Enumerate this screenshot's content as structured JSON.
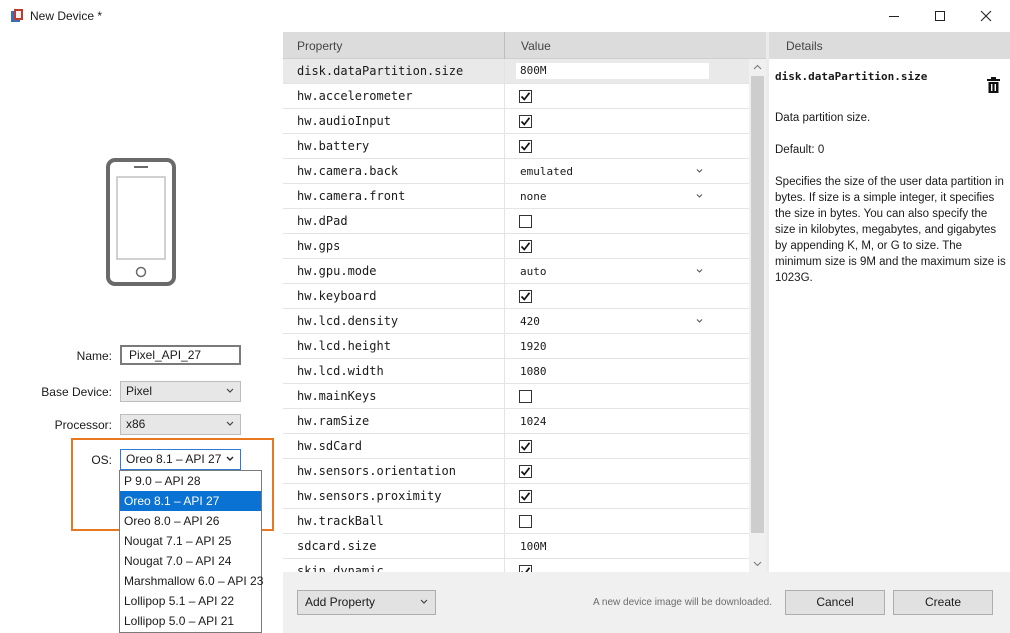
{
  "window": {
    "title": "New Device *"
  },
  "form": {
    "name_label": "Name:",
    "name_value": "Pixel_API_27",
    "base_device_label": "Base Device:",
    "base_device_value": "Pixel",
    "processor_label": "Processor:",
    "processor_value": "x86",
    "os_label": "OS:",
    "os_value": "Oreo 8.1 – API 27"
  },
  "os_options": [
    "P 9.0 – API 28",
    "Oreo 8.1 – API 27",
    "Oreo 8.0 – API 26",
    "Nougat 7.1 – API 25",
    "Nougat 7.0 – API 24",
    "Marshmallow 6.0 – API 23",
    "Lollipop 5.1 – API 22",
    "Lollipop 5.0 – API 21"
  ],
  "os_selected_index": 1,
  "grid": {
    "property_header": "Property",
    "value_header": "Value",
    "rows": [
      {
        "name": "disk.dataPartition.size",
        "type": "text",
        "value": "800M",
        "selected": true
      },
      {
        "name": "hw.accelerometer",
        "type": "check",
        "checked": true
      },
      {
        "name": "hw.audioInput",
        "type": "check",
        "checked": true
      },
      {
        "name": "hw.battery",
        "type": "check",
        "checked": true
      },
      {
        "name": "hw.camera.back",
        "type": "combo",
        "value": "emulated"
      },
      {
        "name": "hw.camera.front",
        "type": "combo",
        "value": "none"
      },
      {
        "name": "hw.dPad",
        "type": "check",
        "checked": false
      },
      {
        "name": "hw.gps",
        "type": "check",
        "checked": true
      },
      {
        "name": "hw.gpu.mode",
        "type": "combo",
        "value": "auto"
      },
      {
        "name": "hw.keyboard",
        "type": "check",
        "checked": true
      },
      {
        "name": "hw.lcd.density",
        "type": "combo",
        "value": "420"
      },
      {
        "name": "hw.lcd.height",
        "type": "text",
        "value": "1920"
      },
      {
        "name": "hw.lcd.width",
        "type": "text",
        "value": "1080"
      },
      {
        "name": "hw.mainKeys",
        "type": "check",
        "checked": false
      },
      {
        "name": "hw.ramSize",
        "type": "text",
        "value": "1024"
      },
      {
        "name": "hw.sdCard",
        "type": "check",
        "checked": true
      },
      {
        "name": "hw.sensors.orientation",
        "type": "check",
        "checked": true
      },
      {
        "name": "hw.sensors.proximity",
        "type": "check",
        "checked": true
      },
      {
        "name": "hw.trackBall",
        "type": "check",
        "checked": false
      },
      {
        "name": "sdcard.size",
        "type": "text",
        "value": "100M"
      },
      {
        "name": "skin.dynamic",
        "type": "check",
        "checked": true
      }
    ]
  },
  "details": {
    "header": "Details",
    "title": "disk.dataPartition.size",
    "summary": "Data partition size.",
    "default": "Default: 0",
    "description": "Specifies the size of the user data partition in bytes. If size is a simple integer, it specifies the size in bytes. You can also specify the size in kilobytes, megabytes, and gigabytes by appending K, M, or G to size. The minimum size is 9M and the maximum size is 1023G."
  },
  "footer": {
    "add_property_label": "Add Property",
    "note": "A new device image will be downloaded.",
    "cancel_label": "Cancel",
    "create_label": "Create"
  },
  "colors": {
    "accent": "#0a72d2",
    "highlight": "#e87722",
    "header_bg": "#dcdcdc",
    "footer_bg": "#f0f0f0"
  },
  "icons": {
    "app": "device-manager-icon",
    "device_preview": "phone-icon",
    "details_action": "trash-icon"
  }
}
